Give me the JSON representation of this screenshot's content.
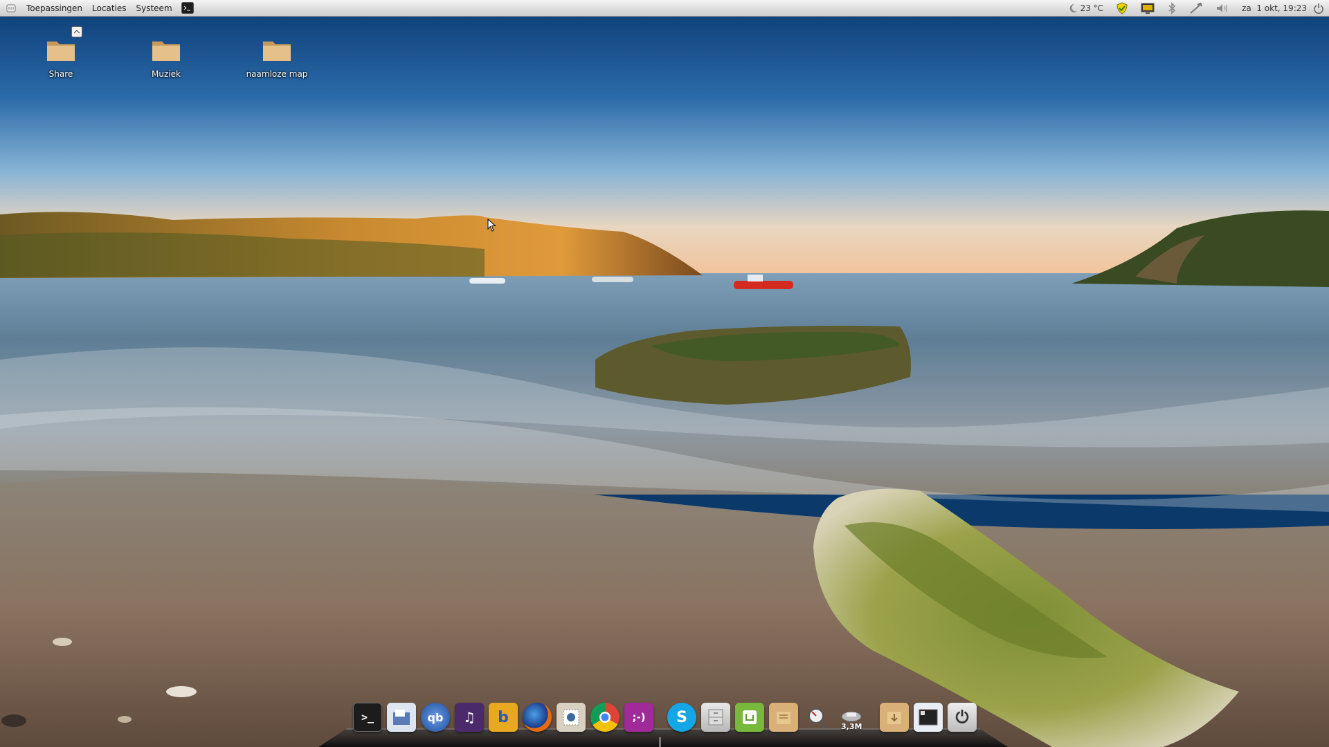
{
  "top_panel": {
    "menus": [
      {
        "label": "Toepassingen"
      },
      {
        "label": "Locaties"
      },
      {
        "label": "Systeem"
      }
    ],
    "temperature": "23 °C",
    "datetime": "za  1 okt, 19:23",
    "tray_icons": [
      "moon-icon",
      "security-shield-icon",
      "monitor-icon",
      "bluetooth-icon",
      "network-icon",
      "volume-icon",
      "power-icon"
    ]
  },
  "desktop_icons": [
    {
      "label": "Share",
      "icon": "folder-icon",
      "emblem": "shared-emblem-icon"
    },
    {
      "label": "Muziek",
      "icon": "folder-icon"
    },
    {
      "label": "naamloze map",
      "icon": "folder-icon"
    }
  ],
  "dock": {
    "items": [
      {
        "name": "terminal",
        "glyph": ">_"
      },
      {
        "name": "file-manager",
        "glyph": ""
      },
      {
        "name": "qbittorrent",
        "glyph": "qb"
      },
      {
        "name": "audio-player",
        "glyph": "♫"
      },
      {
        "name": "banshee",
        "glyph": "b"
      },
      {
        "name": "firefox",
        "glyph": ""
      },
      {
        "name": "mail-client",
        "glyph": ""
      },
      {
        "name": "chrome",
        "glyph": ""
      },
      {
        "name": "emesene-chat",
        "glyph": ";-)"
      },
      {
        "name": "skype",
        "glyph": "S"
      },
      {
        "name": "file-cabinet",
        "glyph": ""
      },
      {
        "name": "mint-software-manager",
        "glyph": ""
      },
      {
        "name": "documents",
        "glyph": ""
      },
      {
        "name": "system-monitor",
        "glyph": ""
      },
      {
        "name": "network-monitor",
        "glyph": ""
      },
      {
        "name": "downloads-folder",
        "glyph": ""
      },
      {
        "name": "show-desktop",
        "glyph": ""
      },
      {
        "name": "shutdown",
        "glyph": "⏻"
      }
    ],
    "network_monitor_label": "3,3M"
  },
  "colors": {
    "panel": "#dcdcdc",
    "sky_top": "#0d3d78",
    "sea": "#5f7f95",
    "sand": "#8a7664"
  }
}
